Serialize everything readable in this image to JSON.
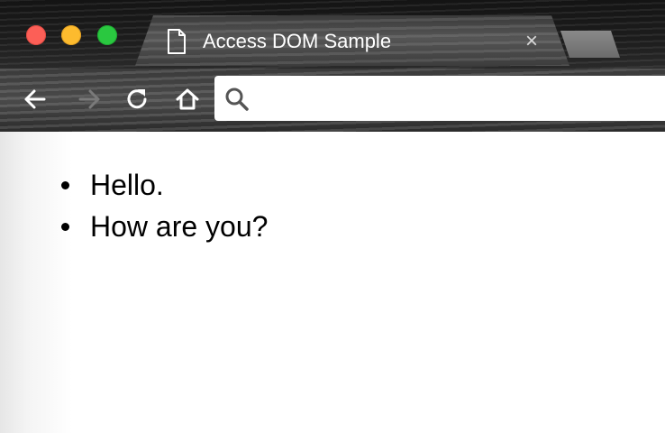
{
  "browser": {
    "tab": {
      "title": "Access DOM Sample",
      "icon": "document-icon",
      "close_glyph": "×"
    },
    "toolbar": {
      "back_icon": "arrow-left-icon",
      "forward_icon": "arrow-right-icon",
      "reload_icon": "reload-icon",
      "home_icon": "home-icon"
    },
    "omnibox": {
      "value": "",
      "placeholder": "",
      "icon": "search-icon"
    },
    "colors": {
      "close": "#fc5f57",
      "minimize": "#fdbb2e",
      "maximize": "#2ac840"
    }
  },
  "page": {
    "list_items": [
      {
        "text": "Hello."
      },
      {
        "text": "How are you?"
      }
    ]
  }
}
